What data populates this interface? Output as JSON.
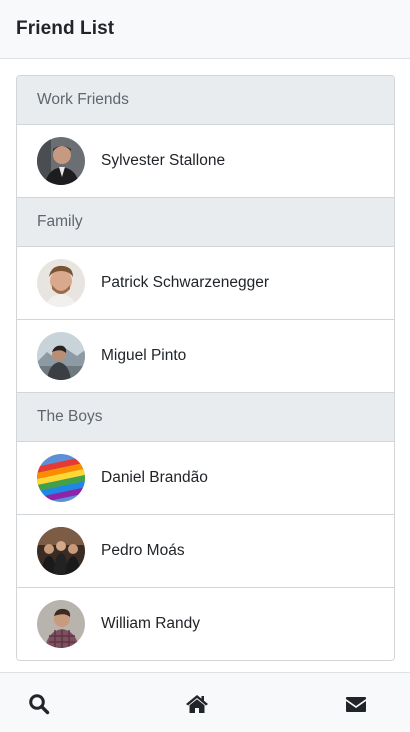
{
  "header": {
    "title": "Friend List"
  },
  "groups": [
    {
      "label": "Work Friends",
      "friends": [
        {
          "name": "Sylvester Stallone",
          "avatar": "photo-avatar"
        }
      ]
    },
    {
      "label": "Family",
      "friends": [
        {
          "name": "Patrick Schwarzenegger",
          "avatar": "photo-avatar"
        },
        {
          "name": "Miguel Pinto",
          "avatar": "photo-avatar"
        }
      ]
    },
    {
      "label": "The Boys",
      "friends": [
        {
          "name": "Daniel Brandão",
          "avatar": "rainbow-flag-avatar"
        },
        {
          "name": "Pedro Moás",
          "avatar": "photo-avatar"
        },
        {
          "name": "William Randy",
          "avatar": "photo-avatar"
        }
      ]
    }
  ],
  "bottom_nav": {
    "items": [
      {
        "icon": "search-icon"
      },
      {
        "icon": "home-icon"
      },
      {
        "icon": "envelope-icon"
      }
    ]
  },
  "colors": {
    "header_bg": "#f8f9fa",
    "group_header_bg": "#e9ecef",
    "border": "#d3d6d9",
    "group_text": "#5f666d",
    "icon": "#212529"
  }
}
